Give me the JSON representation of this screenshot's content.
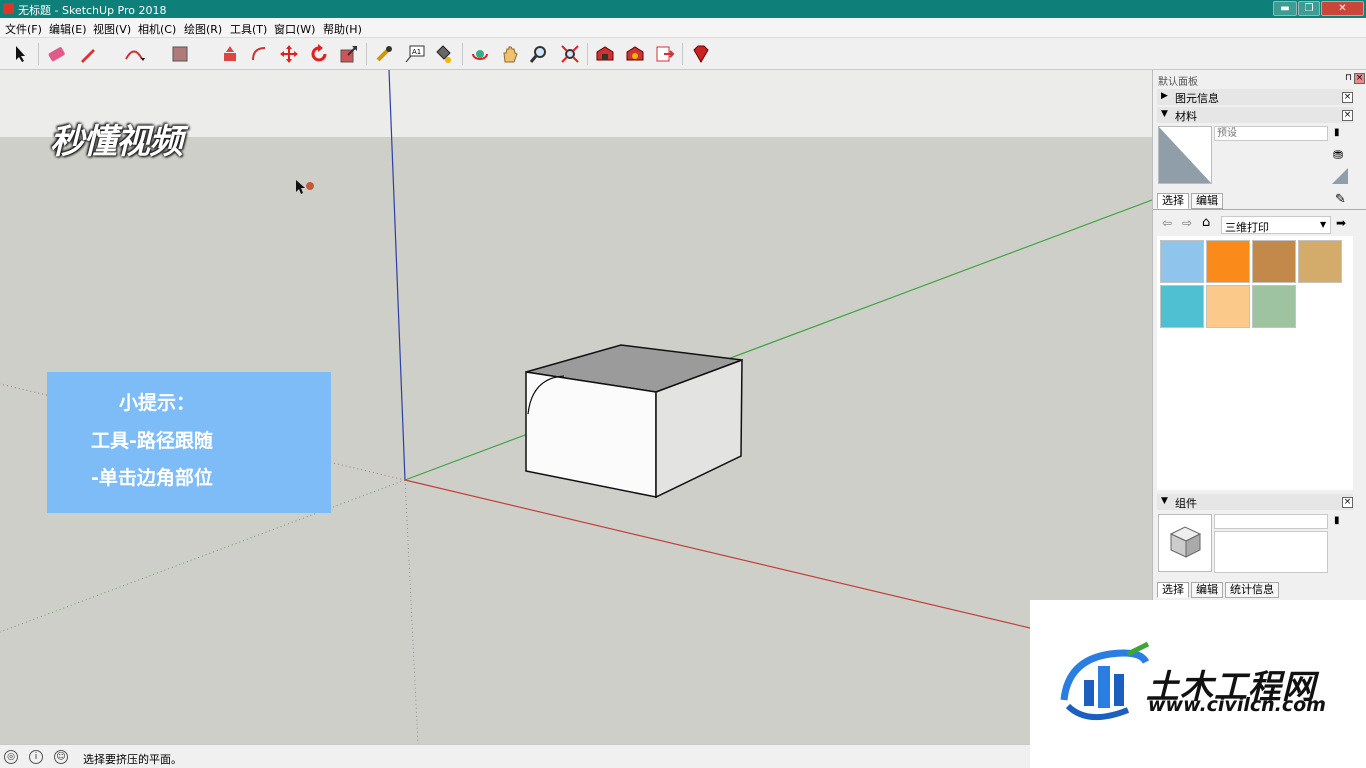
{
  "window": {
    "title": "无标题 - SketchUp Pro 2018",
    "minimize_label": "▬",
    "maximize_label": "❐",
    "close_label": "✕"
  },
  "menu": {
    "items": [
      "文件(F)",
      "编辑(E)",
      "视图(V)",
      "相机(C)",
      "绘图(R)",
      "工具(T)",
      "窗口(W)",
      "帮助(H)"
    ]
  },
  "toolbar": {
    "tools": [
      "select-tool",
      "eraser-tool",
      "pencil-tool",
      "arc-tool",
      "shape-tool",
      "push-pull-tool",
      "offset-tool",
      "move-tool",
      "rotate-tool",
      "scale-tool",
      "tape-measure-tool",
      "text-tool",
      "paint-bucket-tool",
      "orbit-tool",
      "pan-tool",
      "zoom-tool",
      "zoom-extents-tool",
      "warehouse-tool",
      "extension-tool",
      "send-layout-tool",
      "ruby-tool"
    ]
  },
  "viewport": {
    "logo_text": "秒懂视频",
    "hint": {
      "line1": "小提示：",
      "line2": "工具-路径跟随",
      "line3": "-单击边角部位"
    }
  },
  "panel": {
    "title": "默认面板",
    "entity_info_label": "图元信息",
    "materials_label": "材料",
    "material_name_placeholder": "预设",
    "tab_select": "选择",
    "tab_edit": "编辑",
    "library_name": "三维打印",
    "swatches": [
      "#8fc4ec",
      "#fa8a1a",
      "#c2894a",
      "#d3ac6c",
      "#4ec0d2",
      "#fbc98a",
      "#9dc3a0"
    ],
    "components_label": "组件",
    "comp_tab_select": "选择",
    "comp_tab_edit": "编辑",
    "comp_tab_stats": "统计信息",
    "close_symbol": "×"
  },
  "status": {
    "text": "选择要挤压的平面。"
  },
  "watermark": {
    "brand": "土木工程网",
    "url": "www.civilcn.com"
  },
  "colors": {
    "titlebar": "#0f7f79",
    "axis_red": "#c0413a",
    "axis_green": "#3fa33f",
    "axis_blue": "#2e3ea3",
    "hint_box": "#7dbcf7"
  }
}
